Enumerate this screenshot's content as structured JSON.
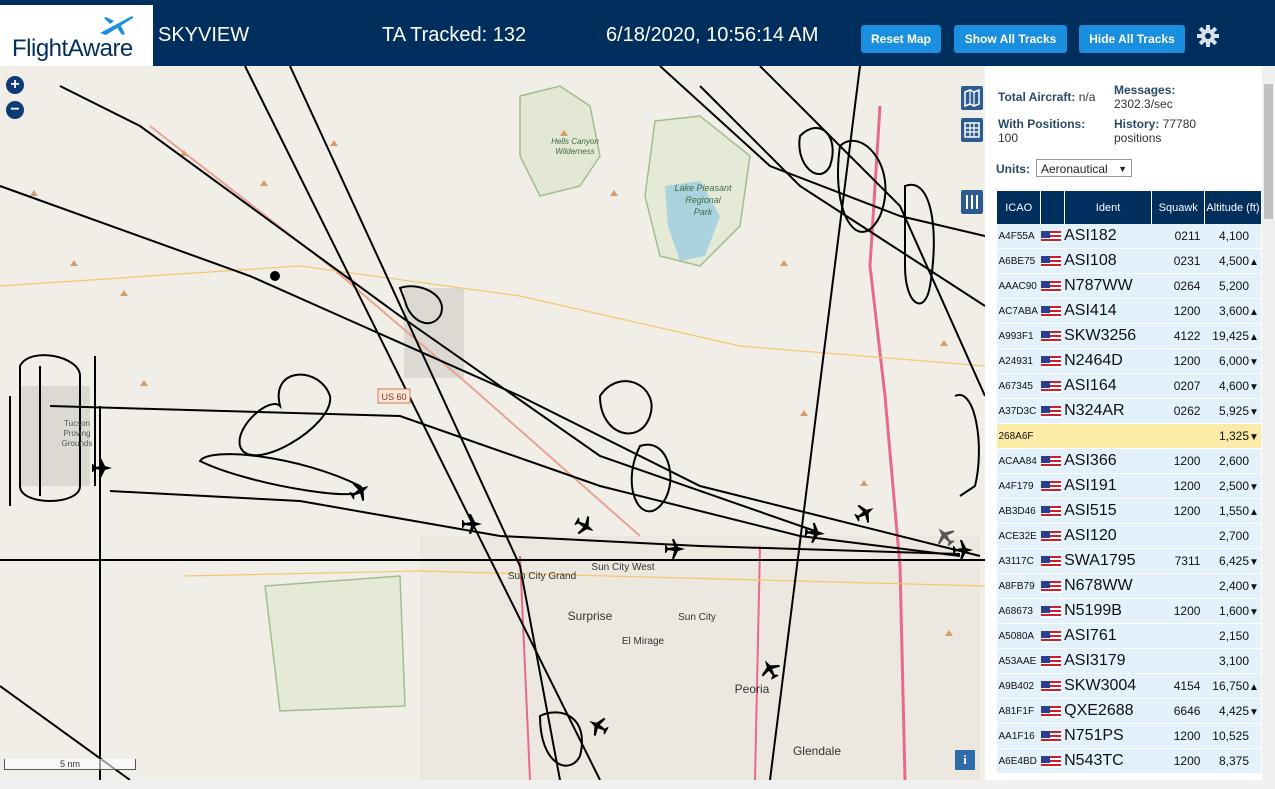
{
  "header": {
    "logo_text": "FlightAware",
    "title": "SKYVIEW",
    "tracked_label": "TA Tracked: 132",
    "datetime": "6/18/2020, 10:56:14 AM",
    "buttons": {
      "reset": "Reset Map",
      "show_all": "Show All Tracks",
      "hide_all": "Hide All Tracks"
    }
  },
  "map": {
    "zoom_in": "+",
    "zoom_out": "−",
    "scale_label": "5 nm",
    "info_label": "i",
    "labels": {
      "hells_canyon": "Hells Canyon\nWilderness",
      "lake_pleasant": "Lake Pleasant\nRegional\nPark",
      "us60": "US 60",
      "sun_city_grand": "Sun City Grand",
      "sun_city_west": "Sun City West",
      "surprise": "Surprise",
      "sun_city": "Sun City",
      "el_mirage": "El Mirage",
      "peoria": "Peoria",
      "glendale": "Glendale",
      "proving": "Tucson\nProving\nGrounds"
    }
  },
  "panel": {
    "total_aircraft_label": "Total Aircraft:",
    "total_aircraft_value": "n/a",
    "with_positions_label": "With Positions:",
    "with_positions_value": "100",
    "messages_label": "Messages:",
    "messages_value": "2302.3/sec",
    "history_label": "History:",
    "history_value": "77780",
    "history_unit": "positions",
    "units_label": "Units:",
    "units_value": "Aeronautical",
    "columns": [
      "ICAO",
      "",
      "Ident",
      "Squawk",
      "Altitude (ft)"
    ],
    "rows": [
      {
        "icao": "A4F55A",
        "flag": "US",
        "ident": "ASI182",
        "squawk": "0211",
        "altitude": "4,100",
        "trend": ""
      },
      {
        "icao": "A6BE75",
        "flag": "US",
        "ident": "ASI108",
        "squawk": "0231",
        "altitude": "4,500",
        "trend": "▲"
      },
      {
        "icao": "AAAC90",
        "flag": "US",
        "ident": "N787WW",
        "squawk": "0264",
        "altitude": "5,200",
        "trend": ""
      },
      {
        "icao": "AC7ABA",
        "flag": "US",
        "ident": "ASI414",
        "squawk": "1200",
        "altitude": "3,600",
        "trend": "▲"
      },
      {
        "icao": "A993F1",
        "flag": "US",
        "ident": "SKW3256",
        "squawk": "4122",
        "altitude": "19,425",
        "trend": "▲"
      },
      {
        "icao": "A24931",
        "flag": "US",
        "ident": "N2464D",
        "squawk": "1200",
        "altitude": "6,000",
        "trend": "▼"
      },
      {
        "icao": "A67345",
        "flag": "US",
        "ident": "ASI164",
        "squawk": "0207",
        "altitude": "4,600",
        "trend": "▼"
      },
      {
        "icao": "A37D3C",
        "flag": "US",
        "ident": "N324AR",
        "squawk": "0262",
        "altitude": "5,925",
        "trend": "▼"
      },
      {
        "icao": "268A6F",
        "flag": "",
        "ident": "",
        "squawk": "",
        "altitude": "1,325",
        "trend": "▼"
      },
      {
        "icao": "ACAA84",
        "flag": "US",
        "ident": "ASI366",
        "squawk": "1200",
        "altitude": "2,600",
        "trend": ""
      },
      {
        "icao": "A4F179",
        "flag": "US",
        "ident": "ASI191",
        "squawk": "1200",
        "altitude": "2,500",
        "trend": "▼"
      },
      {
        "icao": "AB3D46",
        "flag": "US",
        "ident": "ASI515",
        "squawk": "1200",
        "altitude": "1,550",
        "trend": "▲"
      },
      {
        "icao": "ACE32E",
        "flag": "US",
        "ident": "ASI120",
        "squawk": "",
        "altitude": "2,700",
        "trend": ""
      },
      {
        "icao": "A3117C",
        "flag": "US",
        "ident": "SWA1795",
        "squawk": "7311",
        "altitude": "6,425",
        "trend": "▼"
      },
      {
        "icao": "A8FB79",
        "flag": "US",
        "ident": "N678WW",
        "squawk": "",
        "altitude": "2,400",
        "trend": "▼"
      },
      {
        "icao": "A68673",
        "flag": "US",
        "ident": "N5199B",
        "squawk": "1200",
        "altitude": "1,600",
        "trend": "▼"
      },
      {
        "icao": "A5080A",
        "flag": "US",
        "ident": "ASI761",
        "squawk": "",
        "altitude": "2,150",
        "trend": ""
      },
      {
        "icao": "A53AAE",
        "flag": "US",
        "ident": "ASI3179",
        "squawk": "",
        "altitude": "3,100",
        "trend": ""
      },
      {
        "icao": "A9B402",
        "flag": "US",
        "ident": "SKW3004",
        "squawk": "4154",
        "altitude": "16,750",
        "trend": "▲"
      },
      {
        "icao": "A81F1F",
        "flag": "US",
        "ident": "QXE2688",
        "squawk": "6646",
        "altitude": "4,425",
        "trend": "▼"
      },
      {
        "icao": "AA1F16",
        "flag": "US",
        "ident": "N751PS",
        "squawk": "1200",
        "altitude": "10,525",
        "trend": ""
      },
      {
        "icao": "A6E4BD",
        "flag": "US",
        "ident": "N543TC",
        "squawk": "1200",
        "altitude": "8,375",
        "trend": ""
      }
    ],
    "highlighted_row": 8
  },
  "colors": {
    "header_bg": "#002f5d",
    "button_bg": "#1a8fe0",
    "row_bg": "#e3f1fb",
    "row_highlight": "#fbeba6",
    "map_bg": "#f1eee8"
  }
}
